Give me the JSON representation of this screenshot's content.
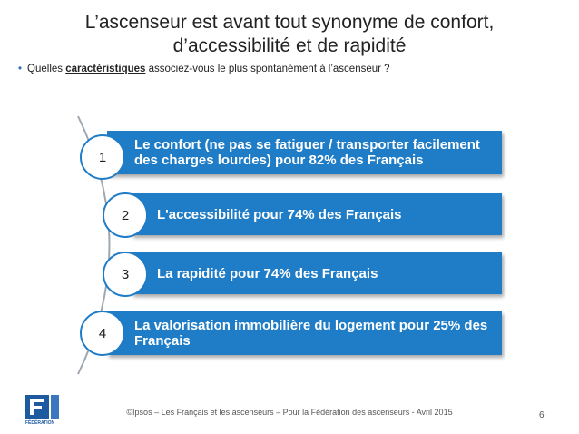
{
  "title": {
    "line1": "L’ascenseur est avant tout synonyme de confort,",
    "line2": "d’accessibilité et de rapidité"
  },
  "bullet": {
    "prefix": "Quelles ",
    "keyword": "caractéristiques",
    "suffix": " associez-vous le plus spontanément à l’ascenseur ?"
  },
  "items": [
    {
      "number": "1",
      "text": "Le confort (ne pas se fatiguer / transporter facilement des charges lourdes) pour 82% des Français"
    },
    {
      "number": "2",
      "text": "L'accessibilité pour 74% des Français"
    },
    {
      "number": "3",
      "text": "La rapidité pour 74% des Français"
    },
    {
      "number": "4",
      "text": "La valorisation immobilière du logement pour 25% des Français"
    }
  ],
  "logo": {
    "caption": "FÉDÉRATION"
  },
  "footer": "©Ipsos – Les Français et les ascenseurs – Pour la Fédération des ascenseurs - Avril 2015",
  "page_number": "6",
  "colors": {
    "accent": "#1f7cc6"
  }
}
